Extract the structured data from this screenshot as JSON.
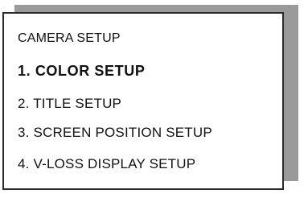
{
  "menu": {
    "title": "CAMERA SETUP",
    "items": [
      {
        "label": "1. COLOR SETUP",
        "selected": true
      },
      {
        "label": "2. TITLE SETUP",
        "selected": false
      },
      {
        "label": "3. SCREEN POSITION SETUP",
        "selected": false
      },
      {
        "label": "4. V-LOSS DISPLAY SETUP",
        "selected": false
      }
    ]
  }
}
